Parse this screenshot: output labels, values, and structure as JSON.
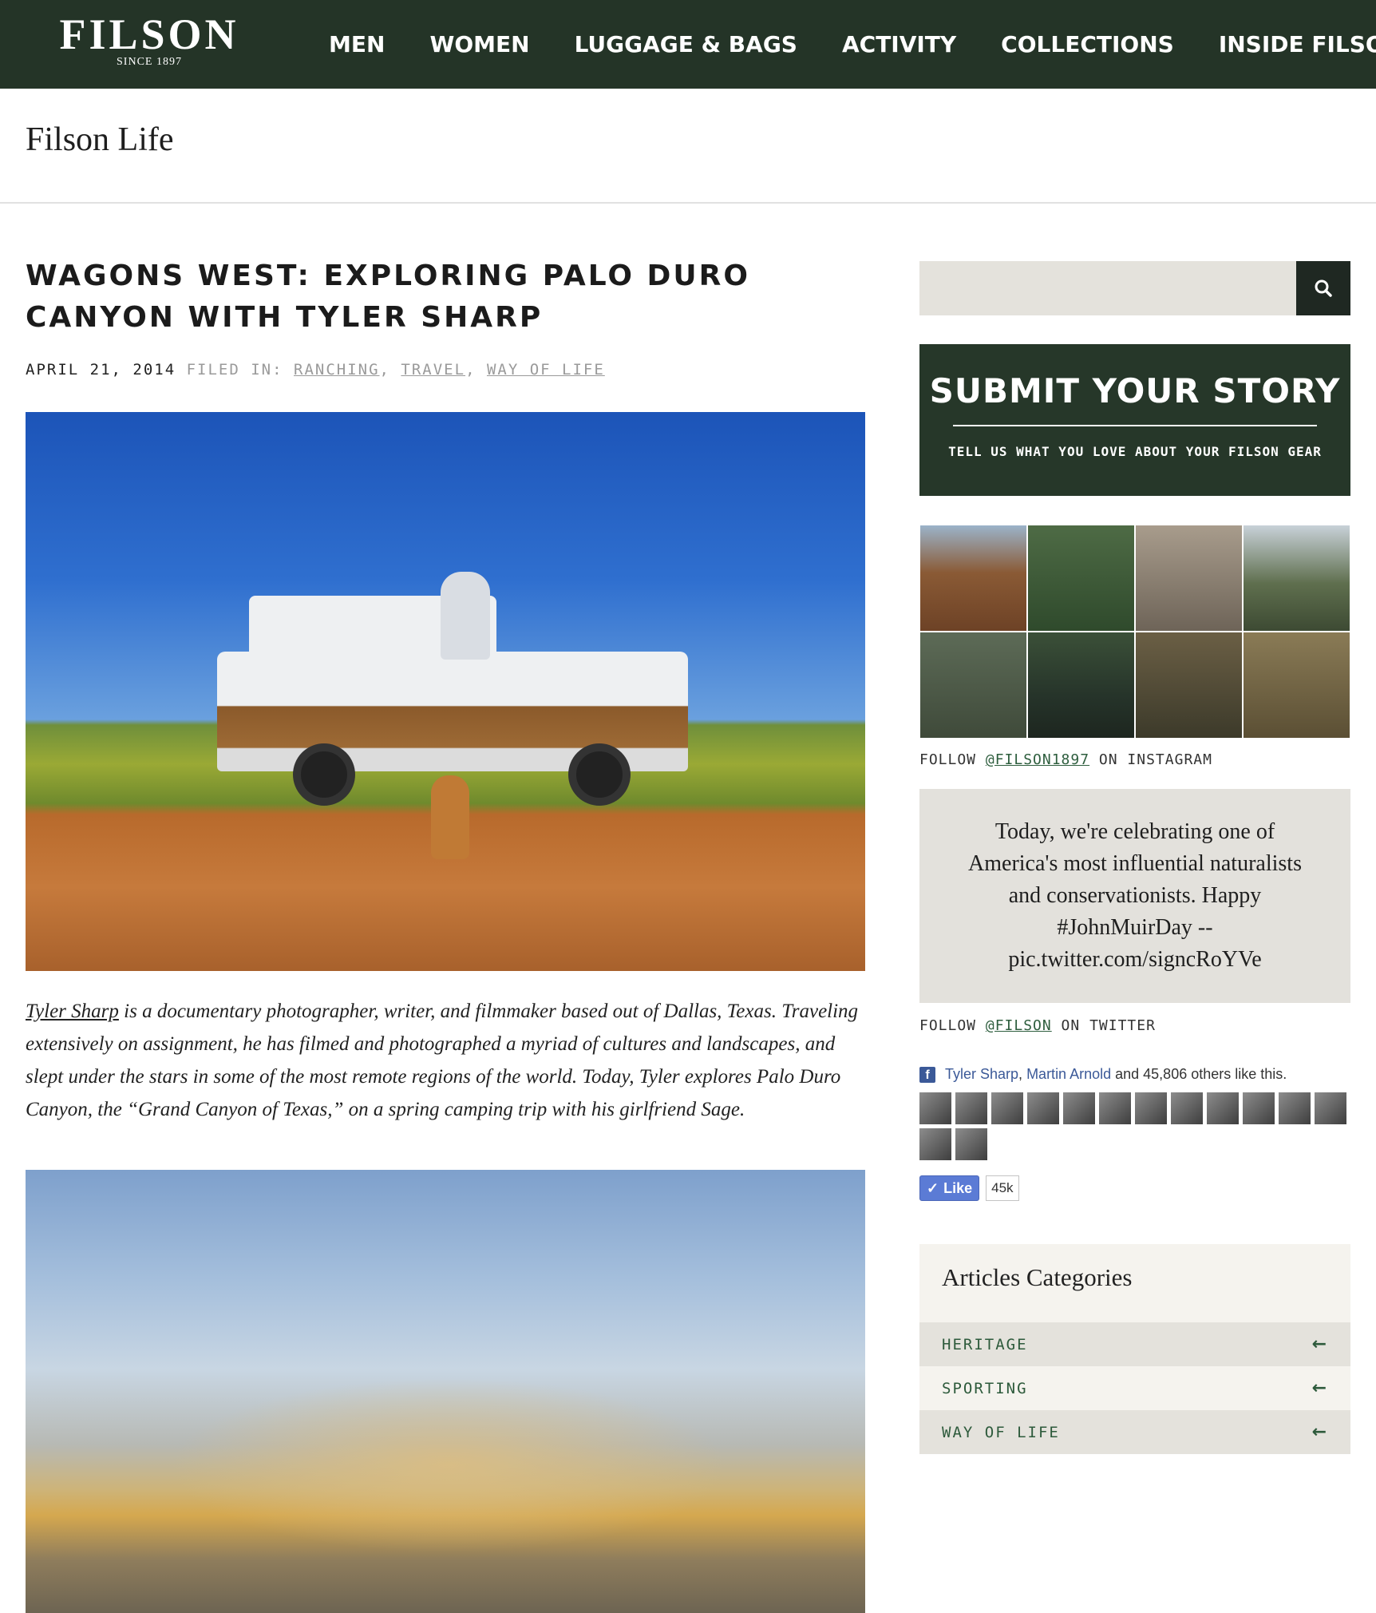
{
  "header": {
    "logo_text": "FILSON",
    "logo_since": "SINCE 1897",
    "nav": [
      "MEN",
      "WOMEN",
      "LUGGAGE & BAGS",
      "ACTIVITY",
      "COLLECTIONS",
      "INSIDE FILSON"
    ]
  },
  "section_title": "Filson Life",
  "article": {
    "title": "WAGONS WEST: EXPLORING PALO DURO CANYON WITH TYLER SHARP",
    "date": "APRIL 21, 2014",
    "filed_label": "FILED IN:",
    "categories": [
      "RANCHING",
      "TRAVEL",
      "WAY OF LIFE"
    ],
    "intro_link": "Tyler Sharp",
    "intro_text": " is a documentary photographer, writer, and filmmaker based out of Dallas, Texas. Traveling extensively on assignment, he has filmed and photographed a myriad of cultures and landscapes, and slept under the stars in some of the most remote regions of the world.  Today, Tyler explores Palo Duro Canyon, the “Grand Canyon of Texas,” on a spring camping trip with his girlfriend Sage."
  },
  "sidebar": {
    "search_placeholder": "",
    "submit": {
      "title": "SUBMIT YOUR STORY",
      "subtitle": "TELL US WHAT YOU LOVE ABOUT YOUR FILSON GEAR"
    },
    "instagram": {
      "follow_prefix": "FOLLOW ",
      "handle": "@FILSON1897",
      "follow_suffix": " ON INSTAGRAM",
      "tile_colors": [
        "#8a5a35",
        "#3b5a36",
        "#7c7368",
        "#6c7b5c",
        "#4c5a44",
        "#2f3f2d",
        "#5b5138",
        "#7a6a45"
      ]
    },
    "tweet": "Today, we're celebrating one of America's most influential naturalists and conservationists. Happy #JohnMuirDay -- pic.twitter.com/signcRoYVe",
    "twitter": {
      "follow_prefix": "FOLLOW ",
      "handle": "@FILSON",
      "follow_suffix": " ON TWITTER"
    },
    "facebook": {
      "friend1": "Tyler Sharp",
      "separator": ", ",
      "friend2": "Martin Arnold",
      "rest": " and 45,806 others like this.",
      "like_label": "Like",
      "like_count": "45k"
    },
    "categories": {
      "title": "Articles Categories",
      "items": [
        "HERITAGE",
        "SPORTING",
        "WAY OF LIFE"
      ]
    }
  }
}
